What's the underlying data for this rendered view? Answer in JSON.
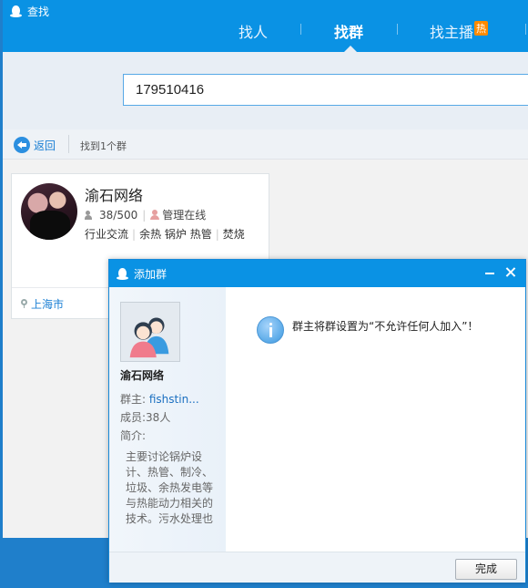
{
  "app": {
    "title": "查找"
  },
  "nav": {
    "tabs": [
      {
        "label": "找人"
      },
      {
        "label": "找群"
      },
      {
        "label": "找主播",
        "badge": "热"
      }
    ],
    "active_tab": "找群"
  },
  "search": {
    "value": "179510416"
  },
  "result_bar": {
    "back_label": "返回",
    "found_text": "找到1个群"
  },
  "group_card": {
    "name": "渝石网络",
    "members": "38/500",
    "admin_status": "管理在线",
    "tags": [
      "行业交流",
      "余热 锅炉 热管",
      "焚烧"
    ],
    "location": "上海市"
  },
  "dialog": {
    "title": "添加群",
    "group_name": "渝石网络",
    "owner_label": "群主:",
    "owner_value": "fishstin...",
    "members_label": "成员:",
    "members_value": "38人",
    "intro_label": "简介:",
    "intro_text": "主要讨论锅炉设计、热管、制冷、垃圾、余热发电等与热能动力相关的技术。污水处理也",
    "message": "群主将群设置为“不允许任何人加入”！",
    "done_label": "完成"
  },
  "colors": {
    "titlebar": "#0a92e4",
    "link": "#1a7fd4",
    "hot_badge": "#ff8a00"
  }
}
